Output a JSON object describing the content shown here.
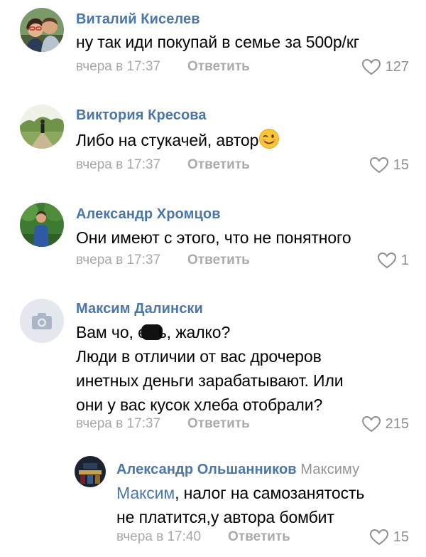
{
  "comments": [
    {
      "author": "Виталий Киселев",
      "lines": [
        "ну так иди покупай в семье за 500р/кг"
      ],
      "time": "вчера в 17:37",
      "reply_label": "Ответить",
      "likes": "127"
    },
    {
      "author": "Виктория Кресова",
      "lines": [
        "Либо на стукачей, автор"
      ],
      "time": "вчера в 17:37",
      "reply_label": "Ответить",
      "likes": "15",
      "emoji": "winking-face"
    },
    {
      "author": "Александр Хромцов",
      "lines": [
        "Они имеют с этого, что не понятного"
      ],
      "time": "вчера в 17:37",
      "reply_label": "Ответить",
      "likes": "1"
    },
    {
      "author": "Максим Далински",
      "lines": [
        "Вам чо, е",
        "ь, жалко?",
        "Люди в отличии от вас дрочеров",
        "инетных деньги зарабатывают. Или",
        "они у вас кусок хлеба отобрали?"
      ],
      "time": "вчера в 17:37",
      "reply_label": "Ответить",
      "likes": "215",
      "avatar": "camera-placeholder-icon"
    },
    {
      "author": "Александр Ольшанников",
      "reply_to": "Максиму",
      "mention": "Максим",
      "lines": [
        ", налог на самозанятость",
        "не платится,у автора бомбит"
      ],
      "time": "вчера в 17:40",
      "reply_label": "Ответить",
      "likes": "15"
    }
  ],
  "colors": {
    "author": "#4a76a8",
    "meta": "#a8a8a8",
    "text": "#000000"
  }
}
